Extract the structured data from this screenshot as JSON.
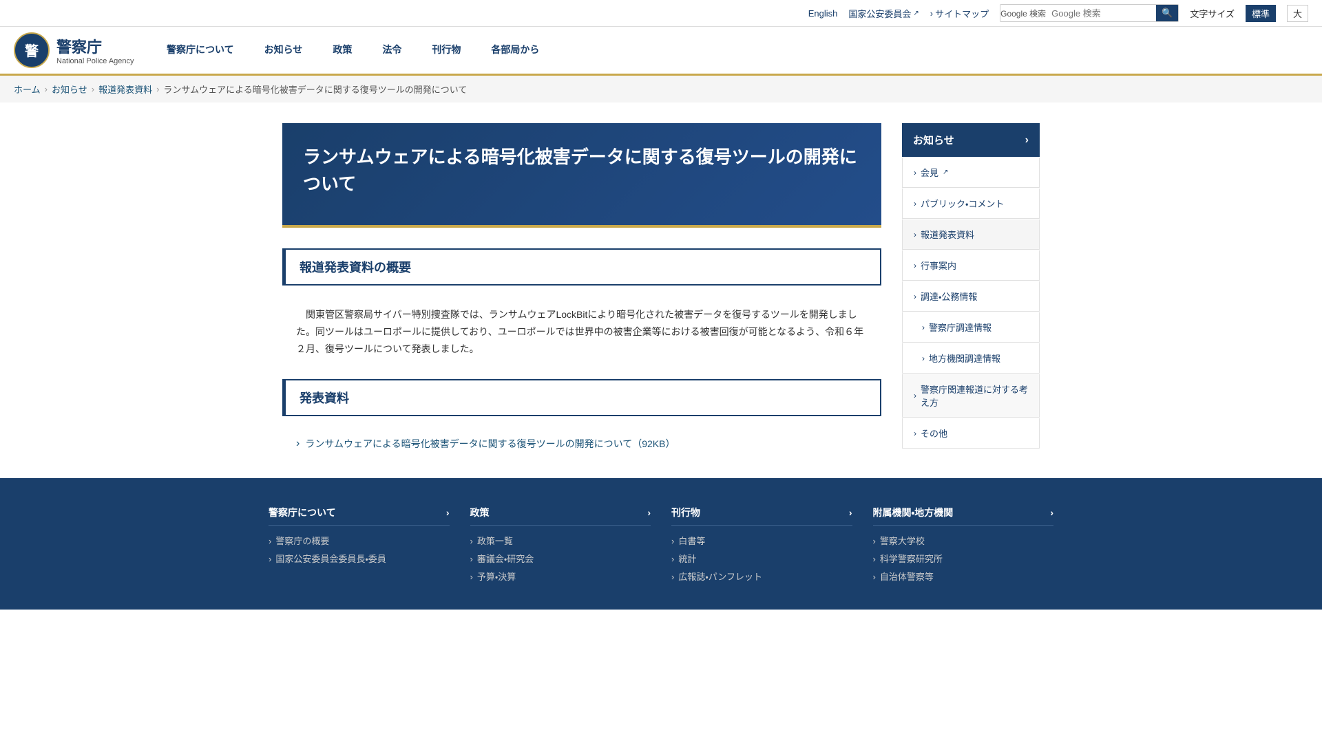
{
  "topbar": {
    "english_label": "English",
    "npa_label": "国家公安委員会",
    "sitemap_label": "サイトマップ",
    "search_placeholder": "Google 検索",
    "search_label": "Google 検索",
    "fontsize_label": "文字サイズ",
    "fontsize_normal": "標準",
    "fontsize_large": "大"
  },
  "header": {
    "logo_jp": "警察庁",
    "logo_en": "National Police Agency",
    "nav": [
      {
        "label": "警察庁について",
        "id": "about"
      },
      {
        "label": "お知らせ",
        "id": "news"
      },
      {
        "label": "政策",
        "id": "policy"
      },
      {
        "label": "法令",
        "id": "law"
      },
      {
        "label": "刊行物",
        "id": "publications"
      },
      {
        "label": "各部局から",
        "id": "bureaus"
      }
    ]
  },
  "breadcrumb": {
    "items": [
      {
        "label": "ホーム",
        "href": "#"
      },
      {
        "label": "お知らせ",
        "href": "#"
      },
      {
        "label": "報道発表資料",
        "href": "#"
      },
      {
        "label": "ランサムウェアによる暗号化被害データに関する復号ツールの開発について"
      }
    ]
  },
  "main": {
    "title": "ランサムウェアによる暗号化被害データに関する復号ツールの開発について",
    "section1": {
      "heading": "報道発表資料の概要",
      "body": "　関東管区警察局サイバー特別捜査隊では、ランサムウェアLockBitにより暗号化された被害データを復号するツールを開発しました。同ツールはユーロポールに提供しており、ユーロポールでは世界中の被害企業等における被害回復が可能となるよう、令和６年２月、復号ツールについて発表しました。"
    },
    "section2": {
      "heading": "発表資料",
      "link_label": "ランサムウェアによる暗号化被害データに関する復号ツールの開発について（92KB）"
    }
  },
  "sidebar": {
    "main_item": "お知らせ",
    "items": [
      {
        "label": "会見",
        "external": true,
        "indent": false
      },
      {
        "label": "パブリック・コメント",
        "external": false,
        "indent": false
      },
      {
        "label": "報道発表資料",
        "external": false,
        "indent": false,
        "active": true
      },
      {
        "label": "行事案内",
        "external": false,
        "indent": false
      },
      {
        "label": "調達・公務情報",
        "external": false,
        "indent": false
      },
      {
        "label": "警察庁調達情報",
        "external": false,
        "indent": true
      },
      {
        "label": "地方機関調達情報",
        "external": false,
        "indent": true
      },
      {
        "label": "警察庁関連報道に対する考え方",
        "external": false,
        "indent": false
      },
      {
        "label": "その他",
        "external": false,
        "indent": false
      }
    ]
  },
  "footer": {
    "columns": [
      {
        "title": "警察庁について",
        "links": [
          {
            "label": "警察庁の概要"
          },
          {
            "label": "国家公安委員会委員長・委員"
          }
        ]
      },
      {
        "title": "政策",
        "links": [
          {
            "label": "政策一覧"
          },
          {
            "label": "審議会・研究会"
          },
          {
            "label": "予算・決算"
          }
        ]
      },
      {
        "title": "刊行物",
        "links": [
          {
            "label": "白書等"
          },
          {
            "label": "統計"
          },
          {
            "label": "広報誌・パンフレット"
          }
        ]
      },
      {
        "title": "附属機関・地方機関",
        "links": [
          {
            "label": "警察大学校"
          },
          {
            "label": "科学警察研究所"
          },
          {
            "label": "自治体警察等"
          }
        ]
      }
    ]
  }
}
